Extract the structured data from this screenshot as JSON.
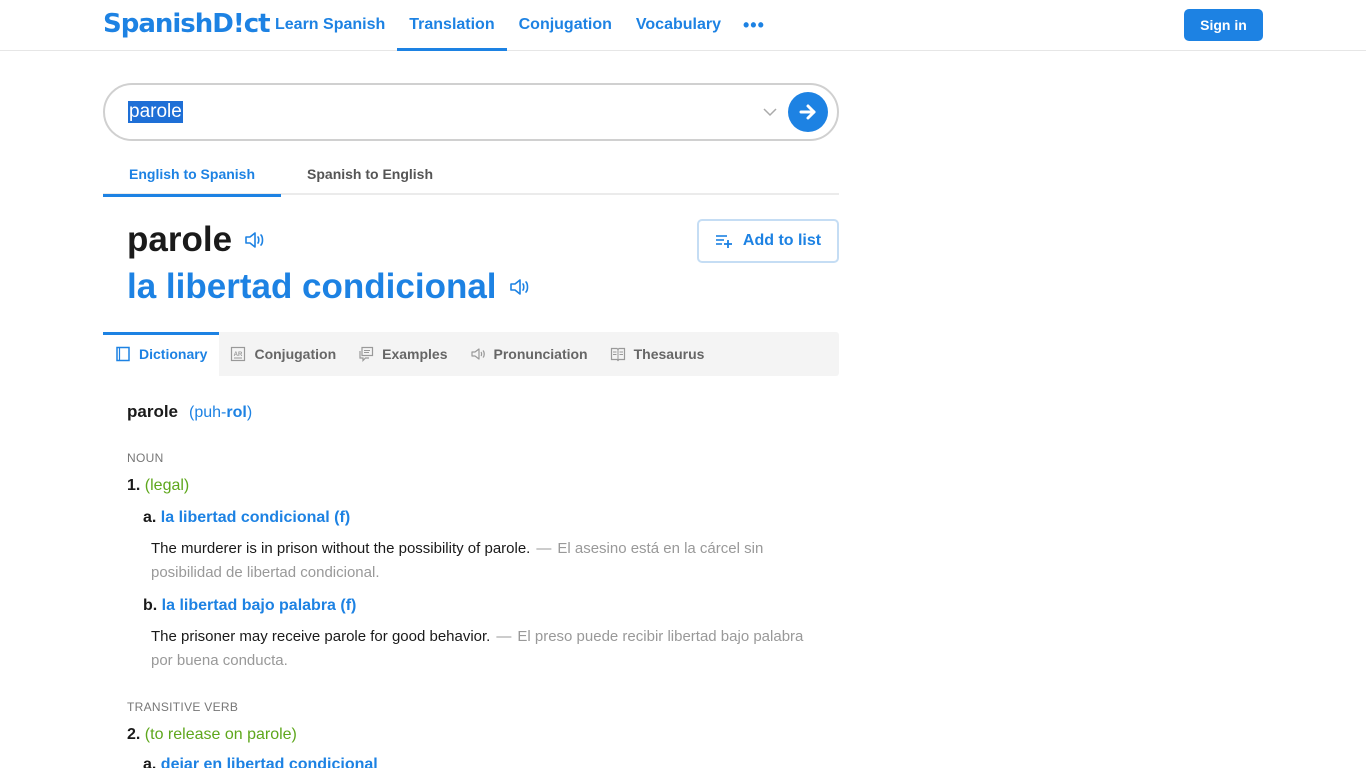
{
  "header": {
    "logo": "SpanishD!ct",
    "nav": [
      {
        "label": "Learn Spanish",
        "active": false
      },
      {
        "label": "Translation",
        "active": true
      },
      {
        "label": "Conjugation",
        "active": false
      },
      {
        "label": "Vocabulary",
        "active": false
      }
    ],
    "more_label": "•••",
    "sign_in": "Sign in"
  },
  "search": {
    "value": "parole",
    "dropdown_icon": "chevron-down-icon",
    "submit_icon": "arrow-right-icon"
  },
  "direction_tabs": [
    {
      "label": "English to Spanish",
      "active": true
    },
    {
      "label": "Spanish to English",
      "active": false
    }
  ],
  "result": {
    "headword": "parole",
    "translation": "la libertad condicional",
    "add_to_list": "Add to list"
  },
  "content_tabs": [
    {
      "label": "Dictionary",
      "icon": "book-icon",
      "active": true
    },
    {
      "label": "Conjugation",
      "icon": "conjugation-icon",
      "active": false
    },
    {
      "label": "Examples",
      "icon": "examples-icon",
      "active": false
    },
    {
      "label": "Pronunciation",
      "icon": "speaker-icon",
      "active": false
    },
    {
      "label": "Thesaurus",
      "icon": "thesaurus-icon",
      "active": false
    }
  ],
  "dictionary": {
    "word": "parole",
    "pron_open": "(puh-",
    "pron_stress": "rol",
    "pron_close": ")",
    "sections": [
      {
        "pos": "NOUN",
        "senses": [
          {
            "number": "1.",
            "context": "(legal)",
            "subsenses": [
              {
                "letter": "a.",
                "translation": "la libertad condicional (f)",
                "example_en": "The murderer is in prison without the possibility of parole.",
                "example_es": "El asesino está en la cárcel sin posibilidad de libertad condicional."
              },
              {
                "letter": "b.",
                "translation": "la libertad bajo palabra (f)",
                "example_en": "The prisoner may receive parole for good behavior.",
                "example_es": "El preso puede recibir libertad bajo palabra por buena conducta."
              }
            ]
          }
        ]
      },
      {
        "pos": "TRANSITIVE VERB",
        "senses": [
          {
            "number": "2.",
            "context": "(to release on parole)",
            "subsenses": [
              {
                "letter": "a.",
                "translation": "dejar en libertad condicional"
              }
            ]
          }
        ]
      }
    ],
    "dash": "—"
  }
}
